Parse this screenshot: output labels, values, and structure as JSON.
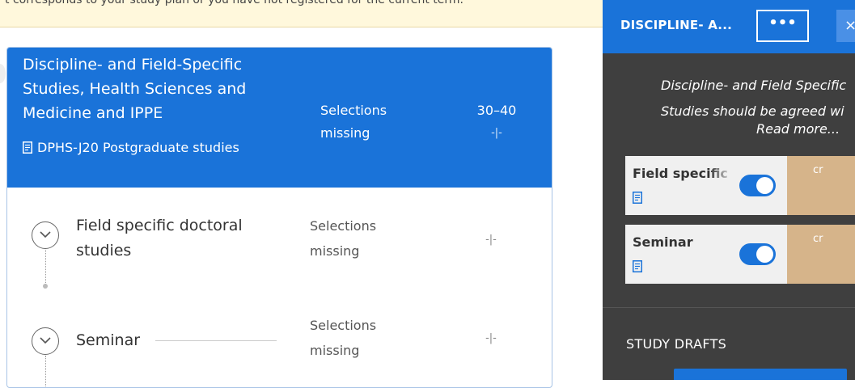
{
  "notice": {
    "text": "t corresponds to your study plan or you have not registered for the current term."
  },
  "module": {
    "title": "Discipline- and Field-Specific Studies, Health Sciences and Medicine and IPPE",
    "plan_code": "DPHS-J20 Postgraduate studies",
    "status": "Selections missing",
    "credits": "30–40",
    "credits_sub": "-|-",
    "color": "#1a73d9"
  },
  "rows": [
    {
      "title": "Field specific doctoral studies",
      "status": "Selections missing",
      "credits": "-|-"
    },
    {
      "title": "Seminar",
      "status": "Selections missing",
      "credits": "-|-"
    }
  ],
  "panel": {
    "title": "DISCIPLINE- A...",
    "more_label": "•••",
    "close_label": "×",
    "description": "Discipline- and Field Specific Studies should be agreed wi",
    "read_more": "Read more...",
    "items": [
      {
        "label": "Field specific",
        "credit_unit": "cr",
        "selected": true
      },
      {
        "label": "Seminar",
        "credit_unit": "cr",
        "selected": true
      }
    ],
    "drafts_heading": "STUDY DRAFTS",
    "colors": {
      "background": "#3f3f3f",
      "accent": "#1a73d9",
      "credit_box": "#d6b48a"
    }
  }
}
